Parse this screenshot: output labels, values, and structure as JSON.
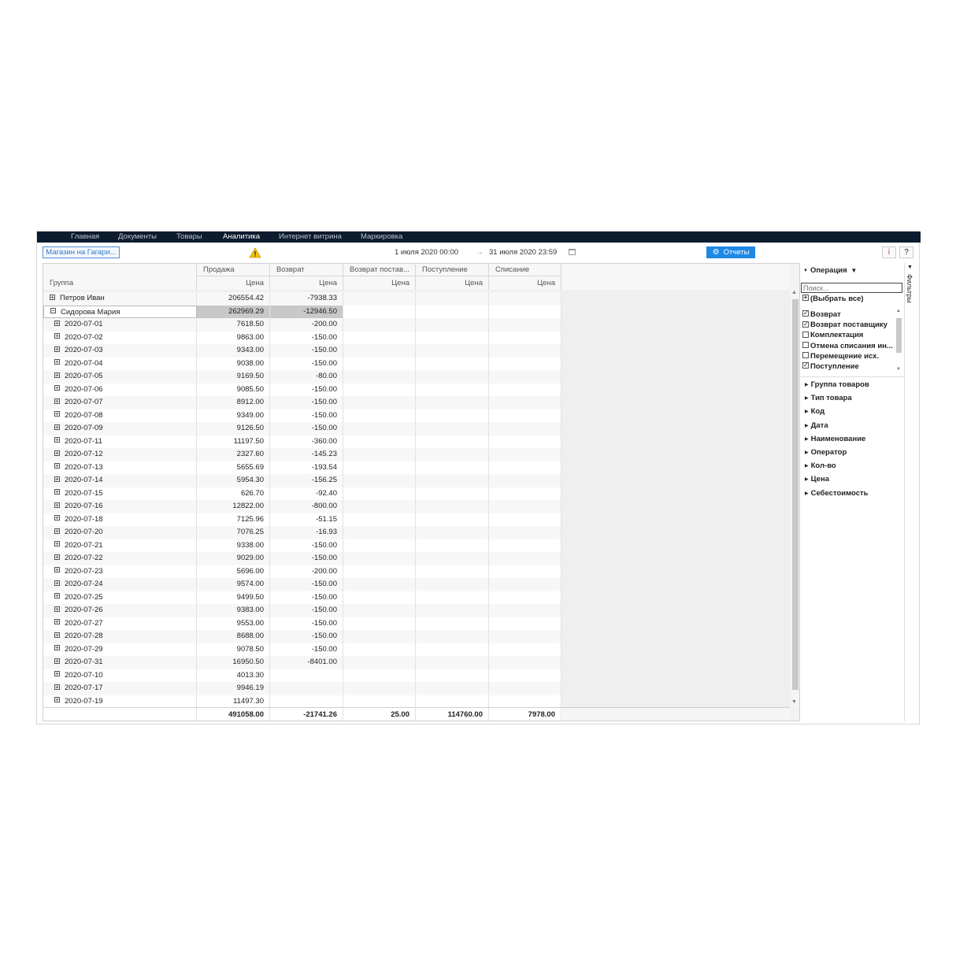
{
  "nav": {
    "items": [
      "Главная",
      "Документы",
      "Товары",
      "Аналитика",
      "Интернет витрина",
      "Маркировка"
    ],
    "active": "Аналитика"
  },
  "toolbar": {
    "store": "Магазин на Гагари...",
    "date_from": "1 июля 2020 00:00",
    "date_to": "31 июля 2020 23:59",
    "reports": "Отчеты",
    "info": "i",
    "help": "?"
  },
  "grid": {
    "group_label": "Группа",
    "columns": [
      {
        "title": "Продажа",
        "sub": "Цена"
      },
      {
        "title": "Возврат",
        "sub": "Цена"
      },
      {
        "title": "Возврат постав...",
        "sub": "Цена"
      },
      {
        "title": "Поступление",
        "sub": "Цена"
      },
      {
        "title": "Списание",
        "sub": "Цена"
      }
    ],
    "rows": [
      {
        "label": "Петров Иван",
        "level": 0,
        "expanded": false,
        "values": [
          "206554.42",
          "-7938.33",
          "",
          "",
          ""
        ]
      },
      {
        "label": "Сидорова Мария",
        "level": 0,
        "expanded": true,
        "selected": true,
        "values": [
          "262969.29",
          "-12946.50",
          "",
          "",
          ""
        ]
      },
      {
        "label": "2020-07-01",
        "level": 1,
        "values": [
          "7618.50",
          "-200.00",
          "",
          "",
          ""
        ]
      },
      {
        "label": "2020-07-02",
        "level": 1,
        "values": [
          "9863.00",
          "-150.00",
          "",
          "",
          ""
        ]
      },
      {
        "label": "2020-07-03",
        "level": 1,
        "values": [
          "9343.00",
          "-150.00",
          "",
          "",
          ""
        ]
      },
      {
        "label": "2020-07-04",
        "level": 1,
        "values": [
          "9038.00",
          "-150.00",
          "",
          "",
          ""
        ]
      },
      {
        "label": "2020-07-05",
        "level": 1,
        "values": [
          "9169.50",
          "-80.00",
          "",
          "",
          ""
        ]
      },
      {
        "label": "2020-07-06",
        "level": 1,
        "values": [
          "9085.50",
          "-150.00",
          "",
          "",
          ""
        ]
      },
      {
        "label": "2020-07-07",
        "level": 1,
        "values": [
          "8912.00",
          "-150.00",
          "",
          "",
          ""
        ]
      },
      {
        "label": "2020-07-08",
        "level": 1,
        "values": [
          "9349.00",
          "-150.00",
          "",
          "",
          ""
        ]
      },
      {
        "label": "2020-07-09",
        "level": 1,
        "values": [
          "9126.50",
          "-150.00",
          "",
          "",
          ""
        ]
      },
      {
        "label": "2020-07-11",
        "level": 1,
        "values": [
          "11197.50",
          "-360.00",
          "",
          "",
          ""
        ]
      },
      {
        "label": "2020-07-12",
        "level": 1,
        "values": [
          "2327.60",
          "-145.23",
          "",
          "",
          ""
        ]
      },
      {
        "label": "2020-07-13",
        "level": 1,
        "values": [
          "5655.69",
          "-193.54",
          "",
          "",
          ""
        ]
      },
      {
        "label": "2020-07-14",
        "level": 1,
        "values": [
          "5954.30",
          "-156.25",
          "",
          "",
          ""
        ]
      },
      {
        "label": "2020-07-15",
        "level": 1,
        "values": [
          "626.70",
          "-92.40",
          "",
          "",
          ""
        ]
      },
      {
        "label": "2020-07-16",
        "level": 1,
        "values": [
          "12822.00",
          "-800.00",
          "",
          "",
          ""
        ]
      },
      {
        "label": "2020-07-18",
        "level": 1,
        "values": [
          "7125.96",
          "-51.15",
          "",
          "",
          ""
        ]
      },
      {
        "label": "2020-07-20",
        "level": 1,
        "values": [
          "7076.25",
          "-16.93",
          "",
          "",
          ""
        ]
      },
      {
        "label": "2020-07-21",
        "level": 1,
        "values": [
          "9338.00",
          "-150.00",
          "",
          "",
          ""
        ]
      },
      {
        "label": "2020-07-22",
        "level": 1,
        "values": [
          "9029.00",
          "-150.00",
          "",
          "",
          ""
        ]
      },
      {
        "label": "2020-07-23",
        "level": 1,
        "values": [
          "5696.00",
          "-200.00",
          "",
          "",
          ""
        ]
      },
      {
        "label": "2020-07-24",
        "level": 1,
        "values": [
          "9574.00",
          "-150.00",
          "",
          "",
          ""
        ]
      },
      {
        "label": "2020-07-25",
        "level": 1,
        "values": [
          "9499.50",
          "-150.00",
          "",
          "",
          ""
        ]
      },
      {
        "label": "2020-07-26",
        "level": 1,
        "values": [
          "9383.00",
          "-150.00",
          "",
          "",
          ""
        ]
      },
      {
        "label": "2020-07-27",
        "level": 1,
        "values": [
          "9553.00",
          "-150.00",
          "",
          "",
          ""
        ]
      },
      {
        "label": "2020-07-28",
        "level": 1,
        "values": [
          "8688.00",
          "-150.00",
          "",
          "",
          ""
        ]
      },
      {
        "label": "2020-07-29",
        "level": 1,
        "values": [
          "9078.50",
          "-150.00",
          "",
          "",
          ""
        ]
      },
      {
        "label": "2020-07-31",
        "level": 1,
        "values": [
          "16950.50",
          "-8401.00",
          "",
          "",
          ""
        ]
      },
      {
        "label": "2020-07-10",
        "level": 1,
        "values": [
          "4013.30",
          "",
          "",
          "",
          ""
        ]
      },
      {
        "label": "2020-07-17",
        "level": 1,
        "values": [
          "9946.19",
          "",
          "",
          "",
          ""
        ]
      },
      {
        "label": "2020-07-19",
        "level": 1,
        "values": [
          "11497.30",
          "",
          "",
          "",
          ""
        ]
      }
    ],
    "totals": [
      "491058.00",
      "-21741.26",
      "25.00",
      "114760.00",
      "7978.00"
    ]
  },
  "filters": {
    "title": "Операция",
    "search_placeholder": "Поиск...",
    "select_all": "(Выбрать все)",
    "options": [
      {
        "label": "Возврат",
        "checked": true
      },
      {
        "label": "Возврат поставщику",
        "checked": true
      },
      {
        "label": "Комплектация",
        "checked": false
      },
      {
        "label": "Отмена списания ин...",
        "checked": false
      },
      {
        "label": "Перемещение исх.",
        "checked": false
      },
      {
        "label": "Поступление",
        "checked": true
      }
    ],
    "collapsed": [
      "Группа товаров",
      "Тип товара",
      "Код",
      "Дата",
      "Наименование",
      "Оператор",
      "Кол-во",
      "Цена",
      "Себестоимость"
    ],
    "side_tab": "Фильтры"
  }
}
